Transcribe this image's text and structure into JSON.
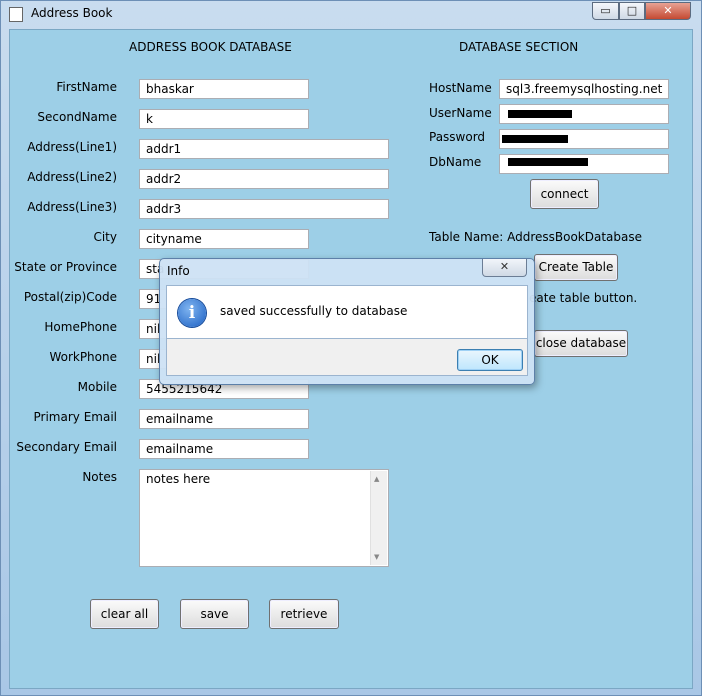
{
  "window": {
    "title": "Address Book",
    "min_label": "▭",
    "max_label": "□",
    "close_label": "✕"
  },
  "left": {
    "header": "ADDRESS BOOK DATABASE",
    "labels": {
      "first_name": "FirstName",
      "second_name": "SecondName",
      "address1": "Address(Line1)",
      "address2": "Address(Line2)",
      "address3": "Address(Line3)",
      "city": "City",
      "state": "State or Province",
      "postal": "Postal(zip)Code",
      "home_phone": "HomePhone",
      "work_phone": "WorkPhone",
      "mobile": "Mobile",
      "primary_email": "Primary Email",
      "secondary_email": "Secondary Email",
      "notes": "Notes"
    },
    "values": {
      "first_name": "bhaskar",
      "second_name": "k",
      "address1": "addr1",
      "address2": "addr2",
      "address3": "addr3",
      "city": "cityname",
      "state": "sta",
      "postal": "91",
      "home_phone": "nil",
      "work_phone": "nil",
      "mobile": "5455215642",
      "primary_email": "emailname",
      "secondary_email": "emailname",
      "notes": "notes here"
    },
    "buttons": {
      "clear_all": "clear all",
      "save": "save",
      "retrieve": "retrieve"
    }
  },
  "right": {
    "header": "DATABASE SECTION",
    "labels": {
      "host": "HostName",
      "user": "UserName",
      "password": "Password",
      "db": "DbName"
    },
    "values": {
      "host": "sql3.freemysqlhosting.net"
    },
    "connect": "connect",
    "table_name": "Table Name: AddressBookDatabase",
    "create_table": "Create Table",
    "hint": "eate table button.",
    "close_db": "close database"
  },
  "dialog": {
    "title": "Info",
    "message": "saved successfully to database",
    "ok": "OK",
    "icon": "i",
    "close_label": "✕"
  },
  "colors": {
    "client_bg": "#9dcfe7",
    "accent": "#3c7fb1"
  }
}
